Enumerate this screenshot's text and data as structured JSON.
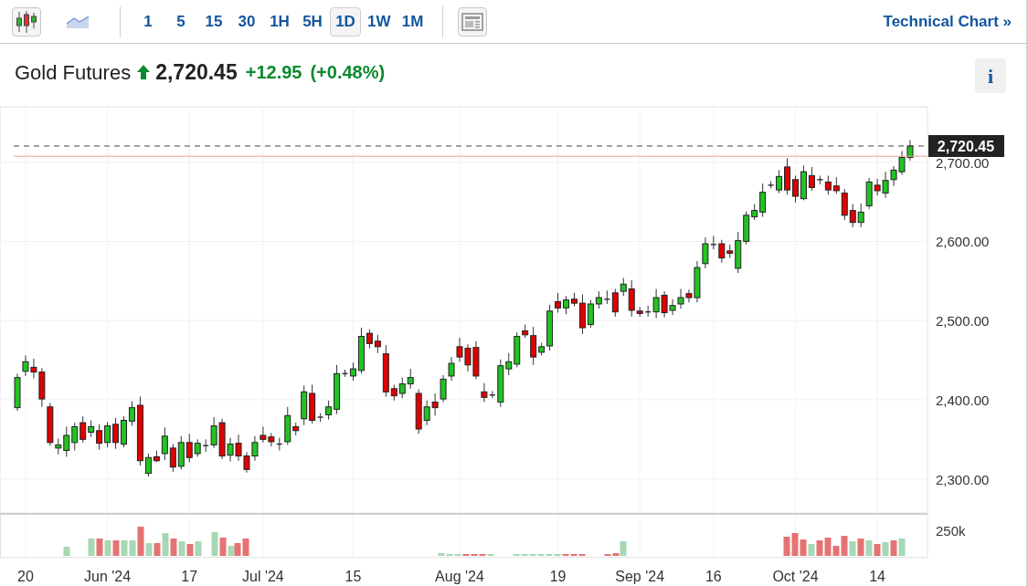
{
  "toolbar": {
    "chart_types": [
      {
        "kind": "candles",
        "selected": true
      },
      {
        "kind": "area",
        "selected": false
      }
    ],
    "intervals": [
      {
        "label": "1",
        "selected": false
      },
      {
        "label": "5",
        "selected": false
      },
      {
        "label": "15",
        "selected": false
      },
      {
        "label": "30",
        "selected": false
      },
      {
        "label": "1H",
        "selected": false
      },
      {
        "label": "5H",
        "selected": false
      },
      {
        "label": "1D",
        "selected": true
      },
      {
        "label": "1W",
        "selected": false
      },
      {
        "label": "1M",
        "selected": false
      }
    ],
    "link": {
      "label": "Technical Chart",
      "arrow": "»"
    }
  },
  "quote": {
    "name": "Gold Futures",
    "rising": true,
    "price": "2,720.45",
    "change": "+12.95",
    "change_percent": "(+0.48%)"
  },
  "info_button": "i",
  "chart": {
    "price_tag": "2,720.45",
    "volume_label": "250k",
    "chart_data": {
      "type": "candlestick",
      "categories": [
        null,
        "20",
        null,
        null,
        null,
        null,
        null,
        null,
        null,
        null,
        null,
        "Jun '24",
        null,
        null,
        null,
        null,
        null,
        null,
        null,
        null,
        null,
        "17",
        null,
        null,
        null,
        null,
        null,
        null,
        null,
        null,
        "Jul '24",
        null,
        null,
        null,
        null,
        null,
        null,
        null,
        null,
        null,
        null,
        "15",
        null,
        null,
        null,
        null,
        null,
        null,
        null,
        null,
        null,
        null,
        null,
        null,
        "Aug '24",
        null,
        null,
        null,
        null,
        null,
        null,
        null,
        null,
        null,
        null,
        null,
        "19",
        null,
        null,
        null,
        null,
        null,
        null,
        null,
        null,
        null,
        "Sep '24",
        null,
        null,
        null,
        null,
        null,
        null,
        null,
        null,
        "16",
        null,
        null,
        null,
        null,
        null,
        null,
        null,
        null,
        null,
        "Oct '24",
        null,
        null,
        null,
        null,
        null,
        null,
        null,
        null,
        null,
        "14",
        null,
        null,
        null,
        null
      ],
      "ohlc": [
        [
          2390,
          2433,
          2386,
          2428
        ],
        [
          2436,
          2456,
          2430,
          2448
        ],
        [
          2441,
          2452,
          2427,
          2435
        ],
        [
          2435,
          2440,
          2391,
          2401
        ],
        [
          2391,
          2396,
          2342,
          2346
        ],
        [
          2339,
          2351,
          2331,
          2343
        ],
        [
          2336,
          2366,
          2328,
          2355
        ],
        [
          2346,
          2371,
          2336,
          2366
        ],
        [
          2371,
          2379,
          2346,
          2350
        ],
        [
          2359,
          2374,
          2353,
          2366
        ],
        [
          2361,
          2369,
          2337,
          2345
        ],
        [
          2346,
          2372,
          2340,
          2367
        ],
        [
          2369,
          2377,
          2338,
          2346
        ],
        [
          2344,
          2379,
          2340,
          2374
        ],
        [
          2373,
          2398,
          2367,
          2390
        ],
        [
          2393,
          2404,
          2317,
          2323
        ],
        [
          2307,
          2332,
          2303,
          2327
        ],
        [
          2328,
          2336,
          2321,
          2323
        ],
        [
          2332,
          2365,
          2324,
          2354
        ],
        [
          2339,
          2344,
          2309,
          2315
        ],
        [
          2316,
          2354,
          2312,
          2346
        ],
        [
          2346,
          2357,
          2321,
          2327
        ],
        [
          2332,
          2350,
          2328,
          2345
        ],
        [
          2342,
          2350,
          2334,
          2342
        ],
        [
          2343,
          2378,
          2339,
          2367
        ],
        [
          2371,
          2376,
          2325,
          2329
        ],
        [
          2330,
          2352,
          2322,
          2344
        ],
        [
          2345,
          2356,
          2323,
          2329
        ],
        [
          2329,
          2334,
          2308,
          2312
        ],
        [
          2329,
          2354,
          2323,
          2346
        ],
        [
          2355,
          2366,
          2346,
          2350
        ],
        [
          2353,
          2358,
          2341,
          2347
        ],
        [
          2344,
          2352,
          2336,
          2344
        ],
        [
          2347,
          2391,
          2343,
          2380
        ],
        [
          2366,
          2371,
          2355,
          2361
        ],
        [
          2376,
          2418,
          2368,
          2410
        ],
        [
          2408,
          2419,
          2370,
          2374
        ],
        [
          2378,
          2383,
          2372,
          2378
        ],
        [
          2381,
          2399,
          2375,
          2391
        ],
        [
          2388,
          2444,
          2382,
          2433
        ],
        [
          2433,
          2438,
          2429,
          2433
        ],
        [
          2430,
          2447,
          2424,
          2439
        ],
        [
          2437,
          2491,
          2433,
          2480
        ],
        [
          2484,
          2489,
          2465,
          2471
        ],
        [
          2474,
          2482,
          2459,
          2467
        ],
        [
          2458,
          2469,
          2404,
          2410
        ],
        [
          2414,
          2419,
          2399,
          2405
        ],
        [
          2408,
          2428,
          2402,
          2420
        ],
        [
          2420,
          2439,
          2414,
          2428
        ],
        [
          2408,
          2413,
          2357,
          2363
        ],
        [
          2374,
          2399,
          2368,
          2391
        ],
        [
          2397,
          2408,
          2380,
          2390
        ],
        [
          2401,
          2431,
          2397,
          2426
        ],
        [
          2430,
          2454,
          2424,
          2446
        ],
        [
          2467,
          2478,
          2448,
          2454
        ],
        [
          2465,
          2470,
          2436,
          2444
        ],
        [
          2466,
          2474,
          2426,
          2430
        ],
        [
          2410,
          2421,
          2397,
          2403
        ],
        [
          2406,
          2411,
          2402,
          2406
        ],
        [
          2397,
          2451,
          2391,
          2443
        ],
        [
          2439,
          2459,
          2431,
          2448
        ],
        [
          2445,
          2485,
          2441,
          2480
        ],
        [
          2487,
          2495,
          2478,
          2482
        ],
        [
          2481,
          2492,
          2444,
          2454
        ],
        [
          2460,
          2472,
          2456,
          2467
        ],
        [
          2468,
          2520,
          2462,
          2512
        ],
        [
          2524,
          2535,
          2510,
          2516
        ],
        [
          2516,
          2531,
          2508,
          2526
        ],
        [
          2527,
          2535,
          2518,
          2522
        ],
        [
          2522,
          2533,
          2483,
          2491
        ],
        [
          2495,
          2526,
          2491,
          2521
        ],
        [
          2521,
          2537,
          2515,
          2529
        ],
        [
          2527,
          2538,
          2521,
          2527
        ],
        [
          2535,
          2540,
          2505,
          2511
        ],
        [
          2537,
          2554,
          2531,
          2546
        ],
        [
          2540,
          2551,
          2505,
          2513
        ],
        [
          2512,
          2517,
          2505,
          2509
        ],
        [
          2511,
          2519,
          2505,
          2511
        ],
        [
          2511,
          2540,
          2503,
          2529
        ],
        [
          2532,
          2537,
          2504,
          2510
        ],
        [
          2513,
          2527,
          2507,
          2519
        ],
        [
          2521,
          2540,
          2515,
          2529
        ],
        [
          2534,
          2539,
          2523,
          2529
        ],
        [
          2529,
          2575,
          2523,
          2567
        ],
        [
          2572,
          2605,
          2566,
          2597
        ],
        [
          2596,
          2607,
          2590,
          2596
        ],
        [
          2597,
          2602,
          2573,
          2579
        ],
        [
          2588,
          2596,
          2579,
          2585
        ],
        [
          2566,
          2612,
          2560,
          2601
        ],
        [
          2600,
          2638,
          2596,
          2633
        ],
        [
          2631,
          2647,
          2627,
          2639
        ],
        [
          2637,
          2673,
          2631,
          2662
        ],
        [
          2671,
          2676,
          2667,
          2671
        ],
        [
          2665,
          2690,
          2661,
          2682
        ],
        [
          2694,
          2705,
          2659,
          2665
        ],
        [
          2678,
          2683,
          2649,
          2657
        ],
        [
          2654,
          2696,
          2652,
          2688
        ],
        [
          2683,
          2694,
          2664,
          2668
        ],
        [
          2678,
          2683,
          2672,
          2678
        ],
        [
          2675,
          2683,
          2659,
          2665
        ],
        [
          2670,
          2681,
          2660,
          2664
        ],
        [
          2661,
          2666,
          2627,
          2633
        ],
        [
          2639,
          2647,
          2618,
          2624
        ],
        [
          2624,
          2648,
          2618,
          2637
        ],
        [
          2645,
          2680,
          2641,
          2675
        ],
        [
          2671,
          2679,
          2658,
          2664
        ],
        [
          2661,
          2688,
          2655,
          2677
        ],
        [
          2678,
          2695,
          2670,
          2690
        ],
        [
          2688,
          2714,
          2684,
          2706
        ],
        [
          2706,
          2728,
          2702,
          2720.45
        ]
      ],
      "ylim": [
        2257,
        2770
      ],
      "grid": true,
      "ref_lines": [
        {
          "axis": "y",
          "value": 2707.5,
          "color": "#e8a0a0"
        },
        {
          "axis": "y",
          "value": 2720.45,
          "color": "#444444"
        }
      ],
      "yticks": [
        {
          "value": 2700,
          "label": "2,700.00"
        },
        {
          "value": 2600,
          "label": "2,600.00"
        },
        {
          "value": 2500,
          "label": "2,500.00"
        },
        {
          "value": 2400,
          "label": "2,400.00"
        },
        {
          "value": 2300,
          "label": "2,300.00"
        }
      ]
    }
  }
}
